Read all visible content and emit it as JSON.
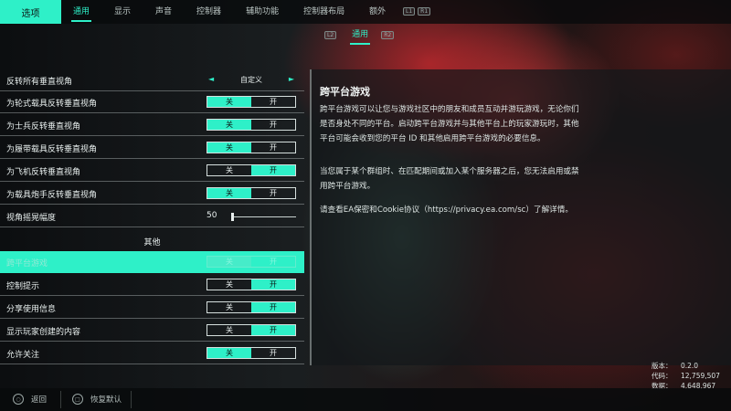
{
  "topbar": {
    "options_tab": "选项",
    "nav": [
      {
        "label": "通用",
        "active": true
      },
      {
        "label": "显示"
      },
      {
        "label": "声音"
      },
      {
        "label": "控制器"
      },
      {
        "label": "辅助功能"
      },
      {
        "label": "控制器布局"
      },
      {
        "label": "额外"
      }
    ],
    "key_hints": [
      "L1",
      "R1"
    ]
  },
  "subtabs": {
    "left_key": "L2",
    "label": "通用",
    "right_key": "R2"
  },
  "settings": {
    "invert_all": {
      "label": "反转所有垂直视角",
      "value": "自定义",
      "left_arrow": "◄",
      "right_arrow": "►"
    },
    "wheeled": {
      "label": "为轮式载具反转垂直视角",
      "off": "关",
      "on": "开",
      "state": "on"
    },
    "soldier": {
      "label": "为士兵反转垂直视角",
      "off": "关",
      "on": "开",
      "state": "on"
    },
    "tracked": {
      "label": "为履带载具反转垂直视角",
      "off": "关",
      "on": "开",
      "state": "on"
    },
    "aircraft": {
      "label": "为飞机反转垂直视角",
      "off": "关",
      "on": "开",
      "state": "on"
    },
    "gunner": {
      "label": "为载具炮手反转垂直视角",
      "off": "关",
      "on": "开",
      "state": "on"
    },
    "sway": {
      "label": "视角摇晃幅度",
      "value": "50",
      "level": 0
    }
  },
  "other_section": {
    "title": "其他",
    "crossplay": {
      "label": "跨平台游戏",
      "off": "关",
      "on": "开",
      "state": "off"
    },
    "hints": {
      "label": "控制提示",
      "off": "关",
      "on": "开",
      "state": "on"
    },
    "usage": {
      "label": "分享使用信息",
      "off": "关",
      "on": "开",
      "state": "on"
    },
    "ugc": {
      "label": "显示玩家创建的内容",
      "off": "关",
      "on": "开",
      "state": "on"
    },
    "follow": {
      "label": "允许关注",
      "off": "关",
      "on": "开",
      "state": "off"
    }
  },
  "info": {
    "title": "跨平台游戏",
    "p1": "跨平台游戏可以让您与游戏社区中的朋友和成员互动并游玩游戏，无论你们是否身处不同的平台。启动跨平台游戏并与其他平台上的玩家游玩时，其他平台可能会收到您的平台 ID 和其他启用跨平台游戏的必要信息。",
    "p2": "当您属于某个群组时、在匹配期间或加入某个服务器之后，您无法启用或禁用跨平台游戏。",
    "p3": "请查看EA保密和Cookie协议（https://privacy.ea.com/sc）了解详情。"
  },
  "version": {
    "version_label": "版本：",
    "version_value": "0.2.0",
    "code_label": "代码：",
    "code_value": "12,759,507",
    "data_label": "数据：",
    "data_value": "4,648,967"
  },
  "bottombar": {
    "back_key": "○",
    "back": "返回",
    "reset_key": "□",
    "reset": "恢复默认"
  },
  "colors": {
    "accent": "#2ef0c8"
  }
}
